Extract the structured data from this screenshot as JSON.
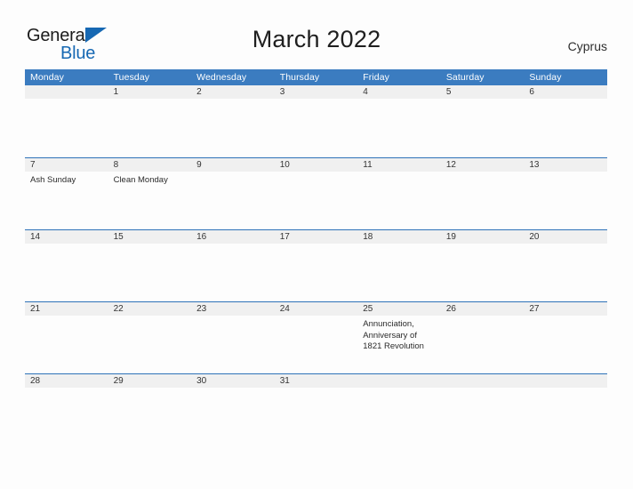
{
  "brand": {
    "word1": "General",
    "word2": "Blue",
    "flag_icon": "blue-triangle-flag",
    "accent_color": "#1668b3"
  },
  "header": {
    "title": "March 2022",
    "country": "Cyprus"
  },
  "calendar": {
    "header_bg": "#3b7cc0",
    "row_line_color": "#2e72b8",
    "day_band_bg": "#f0f0f0",
    "weekday_headers": [
      "Monday",
      "Tuesday",
      "Wednesday",
      "Thursday",
      "Friday",
      "Saturday",
      "Sunday"
    ],
    "weeks": [
      [
        {
          "day": "",
          "events": []
        },
        {
          "day": "1",
          "events": []
        },
        {
          "day": "2",
          "events": []
        },
        {
          "day": "3",
          "events": []
        },
        {
          "day": "4",
          "events": []
        },
        {
          "day": "5",
          "events": []
        },
        {
          "day": "6",
          "events": []
        }
      ],
      [
        {
          "day": "7",
          "events": [
            "Ash Sunday"
          ]
        },
        {
          "day": "8",
          "events": [
            "Clean Monday"
          ]
        },
        {
          "day": "9",
          "events": []
        },
        {
          "day": "10",
          "events": []
        },
        {
          "day": "11",
          "events": []
        },
        {
          "day": "12",
          "events": []
        },
        {
          "day": "13",
          "events": []
        }
      ],
      [
        {
          "day": "14",
          "events": []
        },
        {
          "day": "15",
          "events": []
        },
        {
          "day": "16",
          "events": []
        },
        {
          "day": "17",
          "events": []
        },
        {
          "day": "18",
          "events": []
        },
        {
          "day": "19",
          "events": []
        },
        {
          "day": "20",
          "events": []
        }
      ],
      [
        {
          "day": "21",
          "events": []
        },
        {
          "day": "22",
          "events": []
        },
        {
          "day": "23",
          "events": []
        },
        {
          "day": "24",
          "events": []
        },
        {
          "day": "25",
          "events": [
            "Annunciation, Anniversary of 1821 Revolution"
          ]
        },
        {
          "day": "26",
          "events": []
        },
        {
          "day": "27",
          "events": []
        }
      ],
      [
        {
          "day": "28",
          "events": []
        },
        {
          "day": "29",
          "events": []
        },
        {
          "day": "30",
          "events": []
        },
        {
          "day": "31",
          "events": []
        },
        {
          "day": "",
          "events": []
        },
        {
          "day": "",
          "events": []
        },
        {
          "day": "",
          "events": []
        }
      ]
    ]
  }
}
